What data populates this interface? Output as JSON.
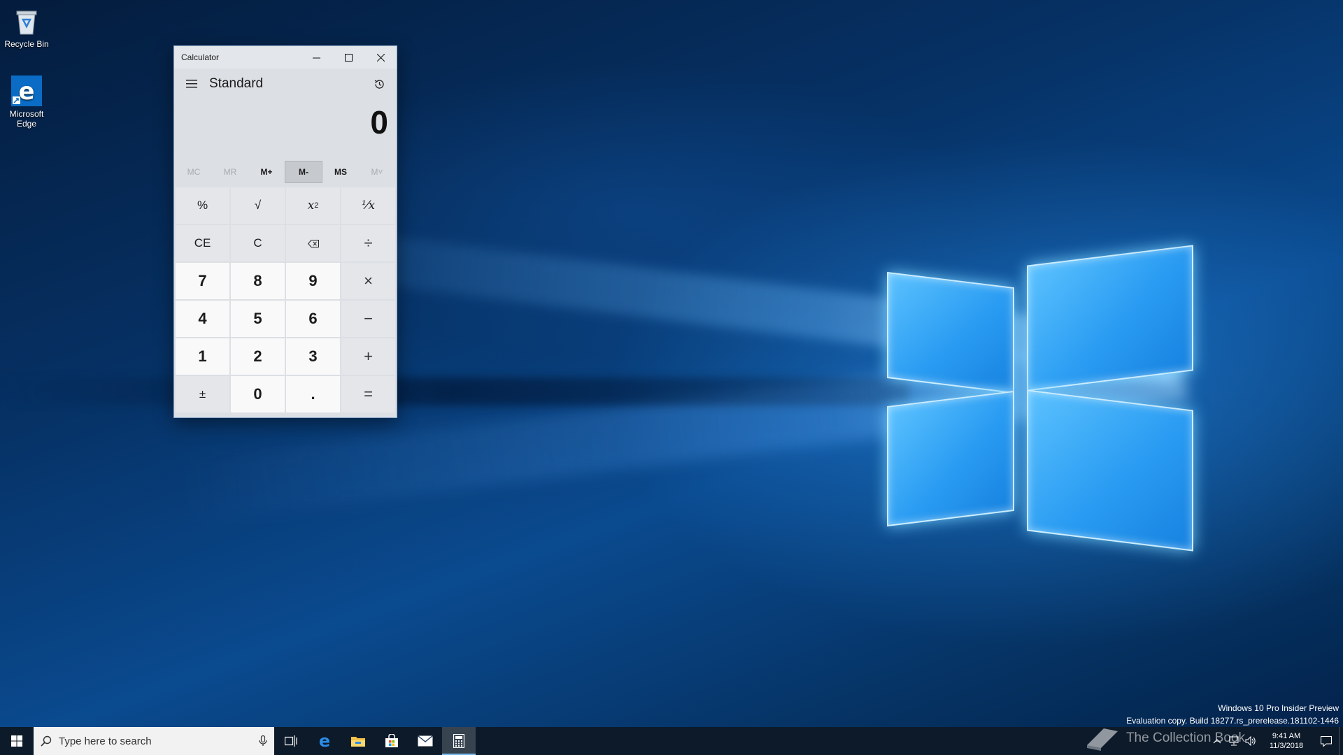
{
  "desktop": {
    "icons": [
      {
        "label": "Recycle Bin",
        "icon": "recycle-bin-icon"
      },
      {
        "label": "Microsoft\nEdge",
        "icon": "edge-icon"
      }
    ]
  },
  "calculator": {
    "window_title": "Calculator",
    "mode": "Standard",
    "display_value": "0",
    "memory_buttons": [
      {
        "label": "MC",
        "enabled": false
      },
      {
        "label": "MR",
        "enabled": false
      },
      {
        "label": "M+",
        "enabled": true
      },
      {
        "label": "M-",
        "enabled": true,
        "hovered": true
      },
      {
        "label": "MS",
        "enabled": true
      },
      {
        "label": "M˅",
        "enabled": false
      }
    ],
    "keys": {
      "percent": "%",
      "sqrt": "√",
      "square_base": "x",
      "square_exp": "2",
      "reciprocal": "⅟x",
      "ce": "CE",
      "c": "C",
      "divide": "÷",
      "seven": "7",
      "eight": "8",
      "nine": "9",
      "multiply": "×",
      "four": "4",
      "five": "5",
      "six": "6",
      "minus": "−",
      "one": "1",
      "two": "2",
      "three": "3",
      "plus": "+",
      "negate": "±",
      "zero": "0",
      "decimal": ".",
      "equals": "="
    }
  },
  "watermark": {
    "line1": "Windows 10 Pro Insider Preview",
    "line2": "Evaluation copy. Build 18277.rs_prerelease.181102-1446"
  },
  "taskbar": {
    "search_placeholder": "Type here to search",
    "pinned": [
      "task-view-icon",
      "edge-icon",
      "file-explorer-icon",
      "store-icon",
      "mail-icon",
      "calculator-icon"
    ],
    "active_app": "calculator-icon",
    "time": "9:41 AM",
    "date": "11/3/2018",
    "brand_text": "The Collection Book"
  },
  "colors": {
    "accent": "#0078d7",
    "taskbar_bg": "#0d1a2a",
    "calc_bg": "#dcdfe4"
  }
}
